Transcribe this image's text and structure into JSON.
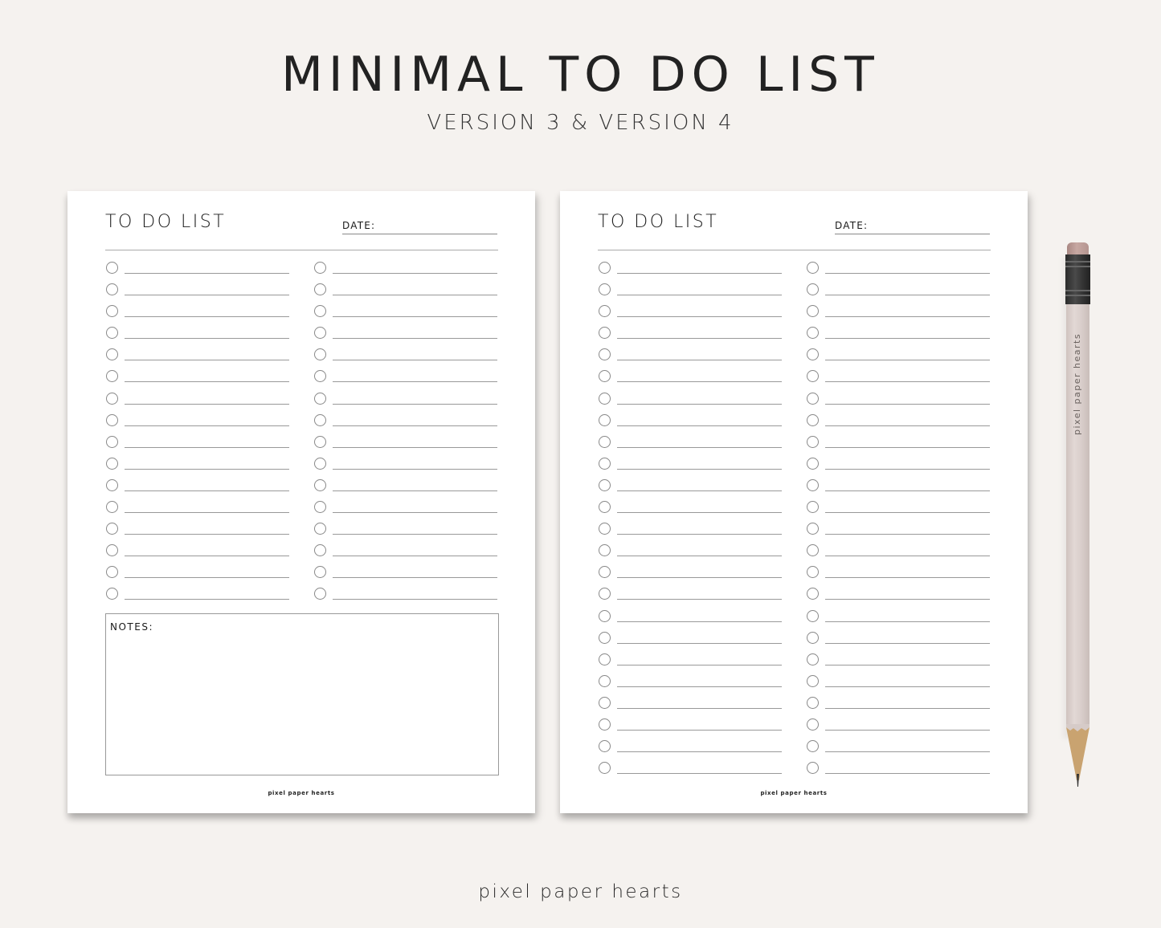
{
  "header": {
    "title": "MINIMAL TO DO LIST",
    "subtitle": "VERSION 3 & VERSION 4"
  },
  "pages": [
    {
      "version": "Version 3",
      "title": "TO DO LIST",
      "date_label": "DATE:",
      "rows_per_column": 16,
      "columns": 2,
      "notes_label": "NOTES:",
      "footer": "pixel paper hearts"
    },
    {
      "version": "Version 4",
      "title": "TO DO LIST",
      "date_label": "DATE:",
      "rows_per_column": 24,
      "columns": 2,
      "footer": "pixel paper hearts"
    }
  ],
  "pencil": {
    "label": "pixel paper hearts",
    "icon": "pencil-icon"
  },
  "footer": {
    "brand": "pixel paper hearts"
  },
  "colors": {
    "background": "#f5f2ef",
    "paper": "#ffffff",
    "ink": "#222222",
    "rule": "#999999",
    "pencil_body": "#ddd2cf",
    "eraser": "#bb9c96"
  }
}
